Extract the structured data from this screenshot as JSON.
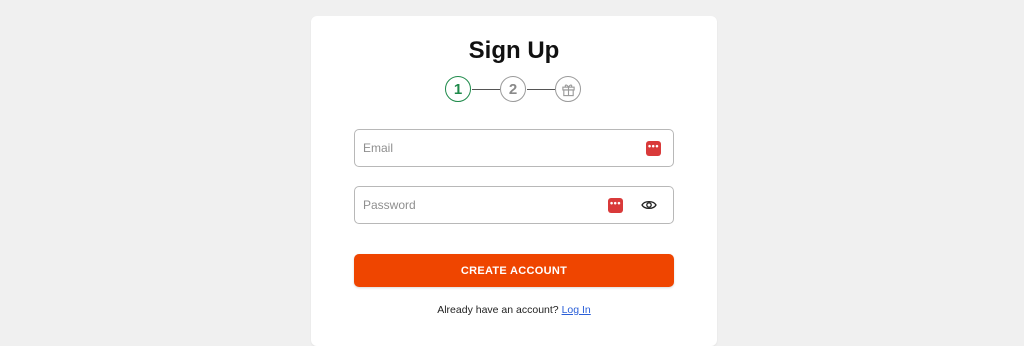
{
  "signup": {
    "title": "Sign Up",
    "steps": [
      {
        "label": "1",
        "active": true
      },
      {
        "label": "2",
        "active": false
      },
      {
        "label": "",
        "icon": "gift-icon",
        "active": false
      }
    ],
    "email": {
      "placeholder": "Email",
      "value": ""
    },
    "password": {
      "placeholder": "Password",
      "value": ""
    },
    "create_button": "CREATE ACCOUNT",
    "login_prompt": "Already have an account?",
    "login_link": "Log In"
  },
  "colors": {
    "background": "#f0f0f0",
    "card": "#ffffff",
    "step_active": "#1e8a4a",
    "step_inactive": "#9a9a9a",
    "button": "#ef4500",
    "link": "#2a5fd8",
    "password_manager": "#d93a3a"
  },
  "icons": [
    "gift-icon",
    "password-manager-icon",
    "eye-icon"
  ]
}
